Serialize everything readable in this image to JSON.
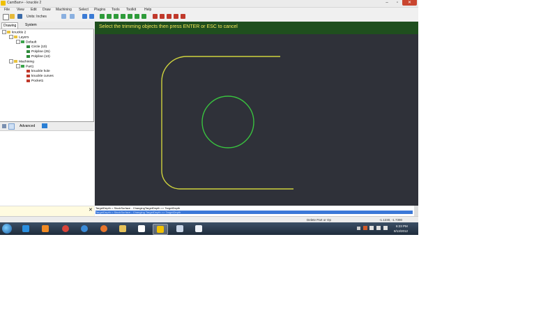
{
  "window": {
    "title": "CamBam+ - knuckle 2",
    "controls": [
      "–",
      "▫",
      "✕"
    ]
  },
  "menu": [
    "File",
    "View",
    "Edit",
    "Draw",
    "Machining",
    "Select",
    "Plugins",
    "Tools",
    "Toolkit",
    "Help"
  ],
  "toolbar": {
    "units": "Units: Inches"
  },
  "left_panel": {
    "tabs": [
      "Drawing",
      "System"
    ],
    "tree": {
      "root": "knuckle 2",
      "layers": "Layers",
      "default_layer": "Default",
      "items": [
        "Circle (10)",
        "Polyline (25)",
        "Polyline (13)"
      ],
      "machining": "Machining",
      "part": "Part1",
      "mops": [
        "knuckle hole",
        "knuckle curves",
        "Pocket1"
      ]
    },
    "prop_label": "Advanced"
  },
  "canvas": {
    "prompt": "Select the trimming objects  then press ENTER or ESC to cancel"
  },
  "command_log": [
    "TargetDepth = StockSurface - ChangingTargetDepth => TargetDepth",
    "TargetDepth = StockSurface - Changing TargetDepth => TargetDepth"
  ],
  "status": {
    "hint": "Delete Part or Op",
    "coords": "-1.1230, -1.7390"
  },
  "taskbar": {
    "time": "6:23 PM",
    "date": "8/13/2012"
  },
  "colors": {
    "canvas_bg": "#2f3139",
    "prompt_bg": "#1f4f1e",
    "prompt_text": "#f6e85a",
    "geometry_yellow": "#cfd33e",
    "geometry_green": "#39c23f"
  }
}
